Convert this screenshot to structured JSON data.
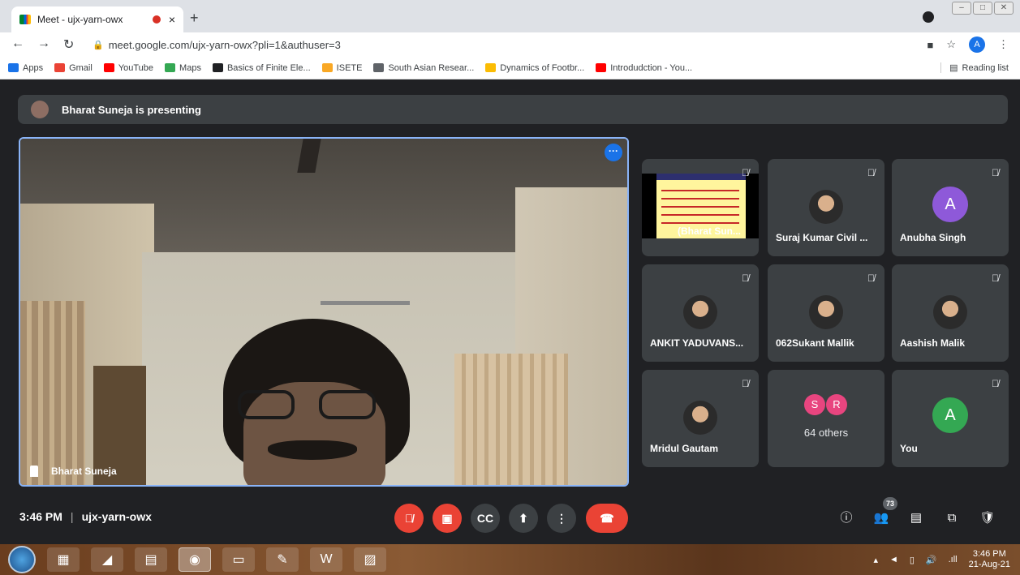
{
  "browser": {
    "tab_title": "Meet - ujx-yarn-owx",
    "tab_close": "×",
    "new_tab": "+",
    "url": "meet.google.com/ujx-yarn-owx?pli=1&authuser=3",
    "profile_letter": "A",
    "bookmarks": [
      {
        "label": "Apps",
        "color": "#1a73e8"
      },
      {
        "label": "Gmail",
        "color": "#ea4335"
      },
      {
        "label": "YouTube",
        "color": "#ff0000"
      },
      {
        "label": "Maps",
        "color": "#34a853"
      },
      {
        "label": "Basics of Finite Ele...",
        "color": "#202124"
      },
      {
        "label": "ISETE",
        "color": "#f9a825"
      },
      {
        "label": "South Asian Resear...",
        "color": "#5f6368"
      },
      {
        "label": "Dynamics of Footbr...",
        "color": "#fbbc04"
      },
      {
        "label": "Introdudction - You...",
        "color": "#ff0000"
      }
    ],
    "reading_list": "Reading list"
  },
  "meet": {
    "presenting_banner": "Bharat Suneja is presenting",
    "main_speaker_name": "Bharat Suneja",
    "tiles": {
      "presentation_label": "(Bharat Sun...",
      "suraj": "Suraj Kumar Civil ...",
      "anubha": "Anubha Singh",
      "anubha_letter": "A",
      "ankit": "ANKIT YADUVANS...",
      "sukant": "062Sukant Mallik",
      "aashish": "Aashish Malik",
      "mridul": "Mridul Gautam",
      "others_letter_s": "S",
      "others_letter_r": "R",
      "others_label": "64 others",
      "you": "You",
      "you_letter": "A"
    },
    "time": "3:46 PM",
    "separator": "|",
    "meeting_code": "ujx-yarn-owx",
    "participant_count": "73"
  },
  "taskbar": {
    "clock_time": "3:46 PM",
    "clock_date": "21-Aug-21"
  },
  "colors": {
    "accent_blue": "#8ab4f8",
    "end_call_red": "#ea4335",
    "anubha_avatar": "#8e59d9",
    "you_avatar": "#34a853",
    "s_avatar": "#e8457f",
    "r_avatar": "#e8457f"
  }
}
